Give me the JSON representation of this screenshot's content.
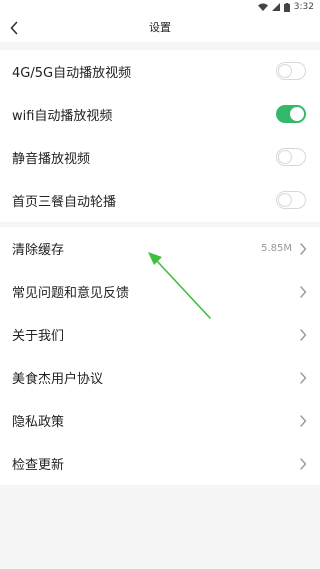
{
  "status_bar": {
    "time": "3:32"
  },
  "header": {
    "title": "设置"
  },
  "toggles": [
    {
      "label": "4G/5G自动播放视频",
      "on": false
    },
    {
      "label": "wifi自动播放视频",
      "on": true
    },
    {
      "label": "静音播放视频",
      "on": false
    },
    {
      "label": "首页三餐自动轮播",
      "on": false
    }
  ],
  "menu": [
    {
      "label": "清除缓存",
      "value": "5.85M"
    },
    {
      "label": "常见问题和意见反馈"
    },
    {
      "label": "关于我们"
    },
    {
      "label": "美食杰用户协议"
    },
    {
      "label": "隐私政策"
    },
    {
      "label": "检查更新"
    }
  ],
  "colors": {
    "accent": "#33b96b",
    "annotation_arrow": "#3fbf3f"
  }
}
